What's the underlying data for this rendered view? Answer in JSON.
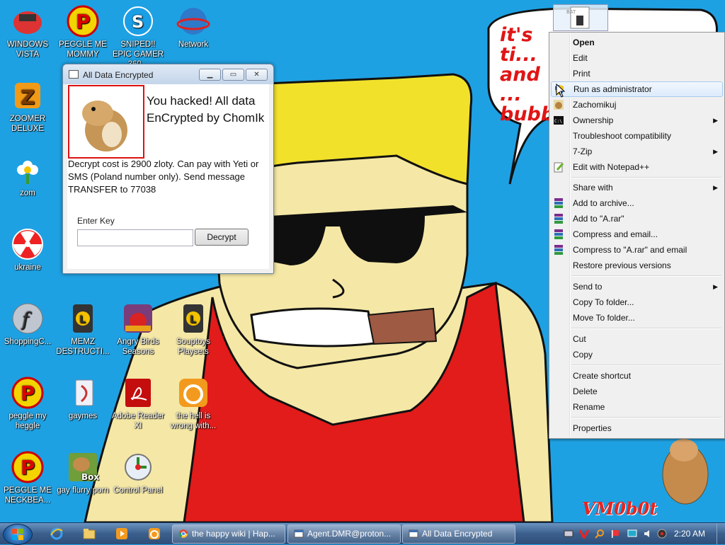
{
  "desktop_icons": [
    {
      "label": "WINDOWS VISTA"
    },
    {
      "label": "PEGGLE ME MOMMY"
    },
    {
      "label": "SNIPED!! EPIC GAMER 360..."
    },
    {
      "label": "Network"
    },
    {
      "label": "ZOOMER DELUXE"
    },
    {
      "label": "zom"
    },
    {
      "label": "ukraine"
    },
    {
      "label": "ShoppingC..."
    },
    {
      "label": "MEMZ DESTRUCTI..."
    },
    {
      "label": "Angry Birds Seasons"
    },
    {
      "label": "Souptoys Playsets"
    },
    {
      "label": "peggle my heggle"
    },
    {
      "label": "gaymes"
    },
    {
      "label": "Adobe Reader XI"
    },
    {
      "label": "the hell is wrong with..."
    },
    {
      "label": "PEGGLE ME NECKBEA..."
    },
    {
      "label": "gay flurry porn"
    },
    {
      "label": "Control Panel"
    }
  ],
  "wallpaper": {
    "bubble_text": "it's ti... and ... bubb...",
    "signature": "VM0b0t"
  },
  "dialog": {
    "title": "All Data Encrypted",
    "heading": "You hacked! All data EnCrypted by ChomIk",
    "message": "Decrypt cost is 2900 zloty. Can pay with Yeti or SMS (Poland number only). Send message TRANSFER to 77038",
    "key_label": "Enter Key",
    "key_value": "",
    "decrypt_label": "Decrypt"
  },
  "file_icon": {
    "label": "BAT"
  },
  "context_menu": {
    "items": [
      {
        "label": "Open",
        "bold": true
      },
      {
        "label": "Edit"
      },
      {
        "label": "Print"
      },
      {
        "label": "Run as administrator",
        "highlighted": true
      },
      {
        "label": "Zachomikuj"
      },
      {
        "label": "Ownership",
        "submenu": true
      },
      {
        "label": "Troubleshoot compatibility"
      },
      {
        "label": "7-Zip",
        "submenu": true
      },
      {
        "label": "Edit with Notepad++"
      },
      {
        "label": "Share with",
        "submenu": true
      },
      {
        "label": "Add to archive..."
      },
      {
        "label": "Add to \"A.rar\""
      },
      {
        "label": "Compress and email..."
      },
      {
        "label": "Compress to \"A.rar\" and email"
      },
      {
        "label": "Restore previous versions"
      },
      {
        "label": "Send to",
        "submenu": true
      },
      {
        "label": "Copy To folder..."
      },
      {
        "label": "Move To folder..."
      },
      {
        "label": "Cut"
      },
      {
        "label": "Copy"
      },
      {
        "label": "Create shortcut"
      },
      {
        "label": "Delete"
      },
      {
        "label": "Rename"
      },
      {
        "label": "Properties"
      }
    ]
  },
  "taskbar": {
    "tasks": [
      {
        "label": "the happy wiki | Hap..."
      },
      {
        "label": "Agent.DMR@proton..."
      },
      {
        "label": "All Data Encrypted"
      }
    ],
    "clock": "2:20 AM"
  }
}
